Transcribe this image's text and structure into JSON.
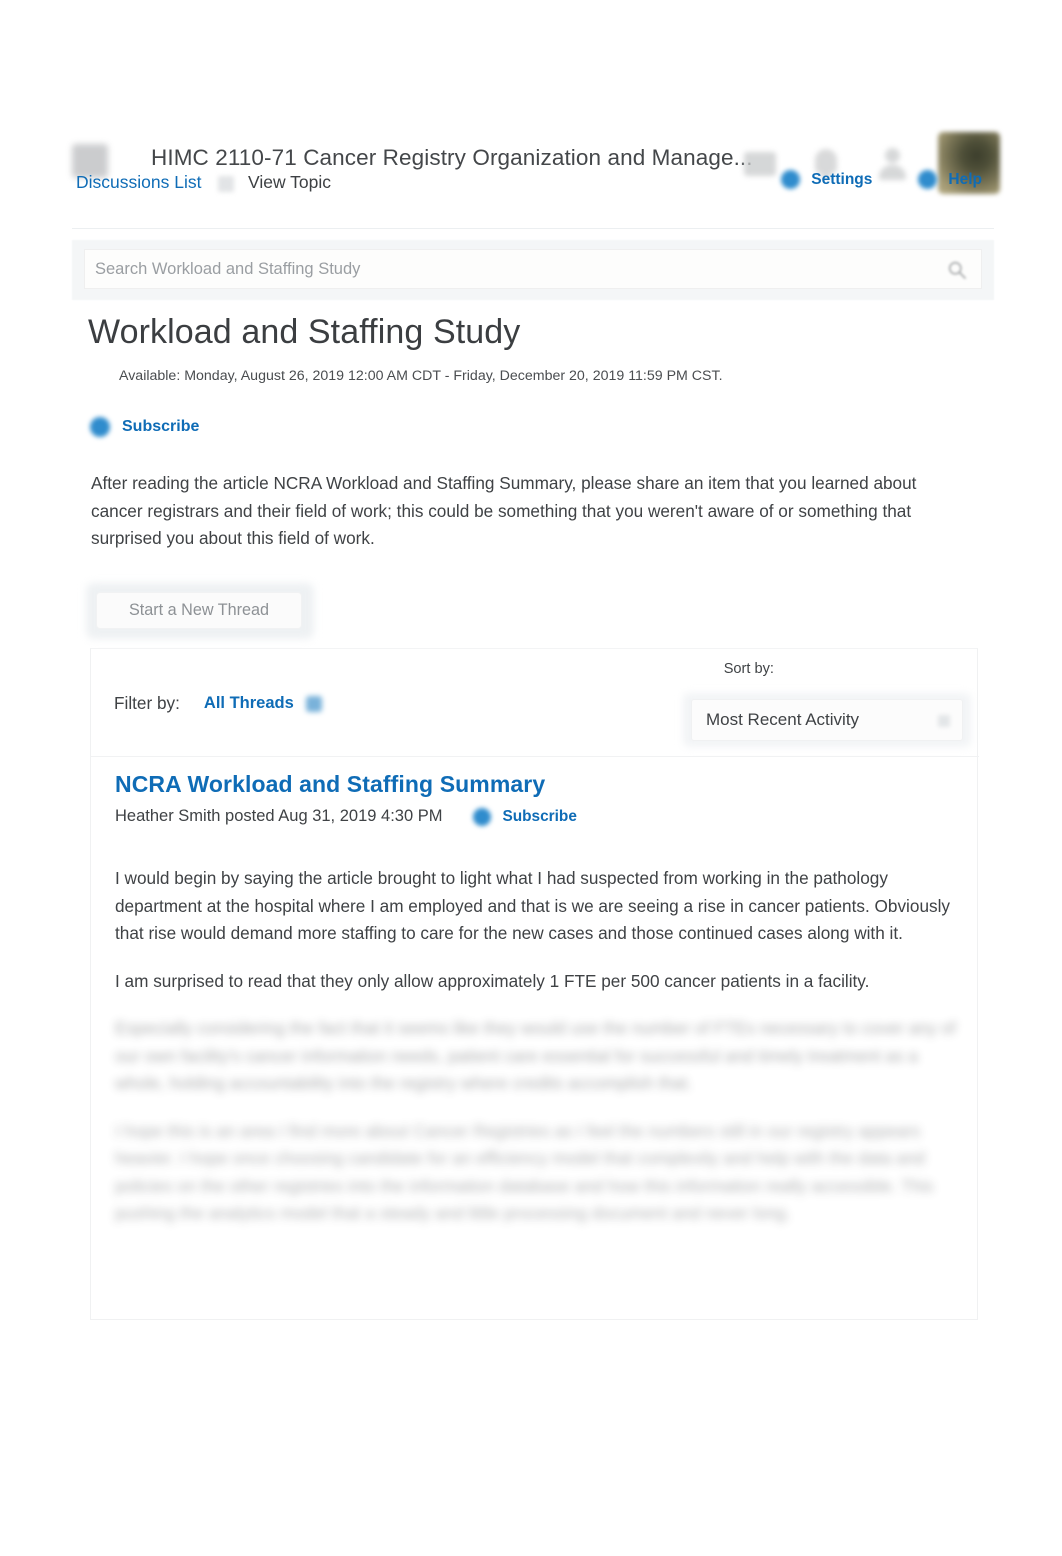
{
  "appbar": {
    "menu_icon": "menu-grid-icon",
    "course_title": "HIMC 2110-71 Cancer Registry Organization and Manage...",
    "icons": [
      "calendar-icon",
      "notifications-bell-icon",
      "account-icon"
    ],
    "avatar_alt": "user-avatar"
  },
  "breadcrumb": {
    "link_label": "Discussions List",
    "separator_icon": "chevron-right-icon",
    "current_label": "View Topic"
  },
  "tools": [
    {
      "label": "Settings",
      "icon": "settings-gear-icon"
    },
    {
      "label": "Help",
      "icon": "help-question-icon"
    }
  ],
  "search": {
    "placeholder": "Search Workload and Staffing Study",
    "value": "",
    "icon": "search-magnifier-icon"
  },
  "topic": {
    "title": "Workload and Staffing Study",
    "availability": "Available: Monday, August 26, 2019 12:00 AM CDT - Friday, December 20, 2019 11:59 PM CST.",
    "subscribe_label": "Subscribe",
    "subscribe_icon": "subscribe-bell-icon",
    "instructions": "After reading the article NCRA Workload and Staffing Summary, please share an item that you learned about cancer registrars and their field of work; this could be something that you weren't aware of or something that surprised you about this field of work."
  },
  "actions": {
    "new_thread_label": "Start a New Thread"
  },
  "threadbar": {
    "filter_label": "Filter by:",
    "filter_value": "All Threads",
    "filter_caret_icon": "chevron-down-icon",
    "sort_label": "Sort by:",
    "sort_value": "Most Recent Activity",
    "sort_arrow_icon": "select-arrow-icon"
  },
  "thread": {
    "title": "NCRA Workload and Staffing Summary",
    "meta": "Heather Smith posted Aug 31, 2019 4:30 PM",
    "subscribe_label": "Subscribe",
    "subscribe_icon": "subscribe-bell-icon",
    "paragraph_1": "I would begin by saying the article brought to light what I had suspected from working in the pathology department at the hospital where I am employed and that is we are seeing a rise in cancer patients. Obviously that rise would demand more staffing to care for the new cases and those continued cases along with it.",
    "paragraph_2": "I am surprised to read that they only allow approximately 1 FTE per 500 cancer patients in a facility.",
    "paragraph_3_redacted": "Especially considering the fact that it seems like they would use the number of FTEs necessary to cover any of our own facility's cancer information needs, patient care essential for successful and timely treatment as a whole, holding accountability into the registry where credits accomplish that.",
    "paragraph_4_redacted": "I hope this is an area I find more about Cancer Registries as I feel the numbers still in our registry appears heavier. I hope once choosing candidate for an efficiency model that complexity and help with the data and policies on the other registries into the information database and how this information really accessible. This pushing the analytics model that a steady and little processing document and never long."
  },
  "colors": {
    "link_blue": "#0f6cb6",
    "text_dark": "#3f4245",
    "page_bg": "#ffffff",
    "band_bg": "#f4f6f7"
  }
}
